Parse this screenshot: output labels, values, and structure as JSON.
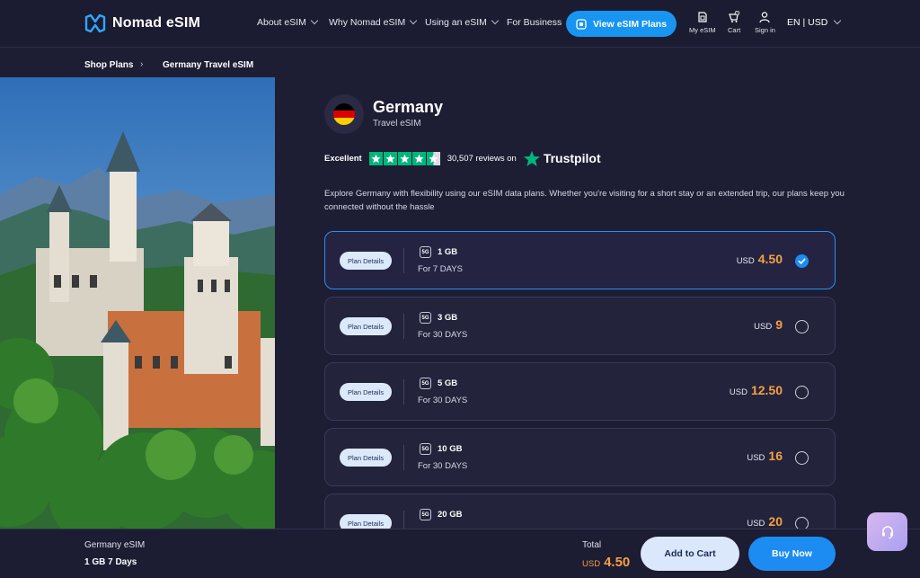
{
  "header": {
    "logo_text": "Nomad eSIM",
    "nav": [
      "About eSIM",
      "Why Nomad eSIM",
      "Using an eSIM",
      "For Business"
    ],
    "view_plans": "View eSIM Plans",
    "my_esim": "My eSIM",
    "cart": "Cart",
    "cart_count": "0",
    "sign_in": "Sign in",
    "lang": "EN | USD"
  },
  "breadcrumb": {
    "shop": "Shop Plans",
    "sep": "›",
    "current": "Germany Travel eSIM"
  },
  "product": {
    "title": "Germany",
    "subtitle": "Travel eSIM",
    "flag_colors": [
      "#000000",
      "#dd0000",
      "#ffce00"
    ]
  },
  "trustpilot": {
    "rating_word": "Excellent",
    "reviews": "30,507 reviews on",
    "brand": "Trustpilot",
    "stars": 4.5,
    "color": "#00b67a"
  },
  "description": "Explore Germany with flexibility using our eSIM data plans. Whether you're visiting for a short stay or an extended trip, our plans keep you connected without the hassle",
  "plans": [
    {
      "details": "Plan Details",
      "badge": "5G",
      "gb": "1 GB",
      "days": "For 7 DAYS",
      "currency": "USD",
      "price": "4.50",
      "selected": true
    },
    {
      "details": "Plan Details",
      "badge": "5G",
      "gb": "3 GB",
      "days": "For 30 DAYS",
      "currency": "USD",
      "price": "9",
      "selected": false
    },
    {
      "details": "Plan Details",
      "badge": "5G",
      "gb": "5 GB",
      "days": "For 30 DAYS",
      "currency": "USD",
      "price": "12.50",
      "selected": false
    },
    {
      "details": "Plan Details",
      "badge": "5G",
      "gb": "10 GB",
      "days": "For 30 DAYS",
      "currency": "USD",
      "price": "16",
      "selected": false
    },
    {
      "details": "Plan Details",
      "badge": "5G",
      "gb": "20 GB",
      "days": "",
      "currency": "USD",
      "price": "20",
      "selected": false
    }
  ],
  "bottom": {
    "name": "Germany eSIM",
    "plan": "1 GB 7 Days",
    "total_label": "Total",
    "currency": "USD",
    "total": "4.50",
    "add_to_cart": "Add to Cart",
    "buy_now": "Buy Now"
  },
  "colors": {
    "accent": "#1d8cf2",
    "price": "#f5a144",
    "background": "#1d1d34"
  }
}
